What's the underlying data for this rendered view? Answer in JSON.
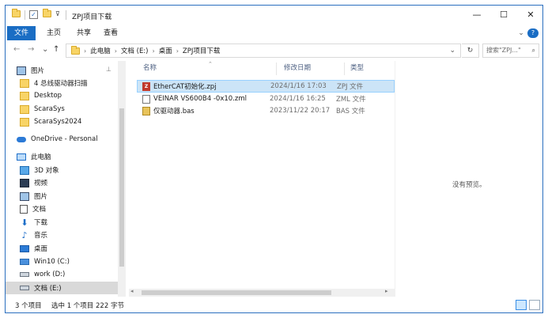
{
  "window": {
    "title": "ZPJ项目下载",
    "controls": {
      "minimize": "—",
      "maximize": "☐",
      "close": "✕"
    }
  },
  "ribbon": {
    "tabs": [
      "文件",
      "主页",
      "共享",
      "查看"
    ],
    "active_tab": 0,
    "help_glyph": "?"
  },
  "address": {
    "crumbs": [
      "此电脑",
      "文档 (E:)",
      "桌面",
      "ZPJ项目下载"
    ],
    "search_placeholder": "搜索\"ZPJ...\"",
    "nav": {
      "back": "←",
      "forward": "→",
      "recent": "⌄",
      "up": "↑"
    }
  },
  "nav_pane": {
    "items": [
      {
        "label": "图片",
        "icon": "picture-icon",
        "pinned": true
      },
      {
        "label": "4 总线驱动器扫描",
        "icon": "folder-icon"
      },
      {
        "label": "Desktop",
        "icon": "folder-icon"
      },
      {
        "label": "ScaraSys",
        "icon": "folder-icon"
      },
      {
        "label": "ScaraSys2024",
        "icon": "folder-icon"
      },
      {
        "label": "OneDrive - Personal",
        "icon": "onedrive-icon"
      },
      {
        "label": "此电脑",
        "icon": "this-pc-icon"
      },
      {
        "label": "3D 对象",
        "icon": "3d-objects-icon"
      },
      {
        "label": "视频",
        "icon": "video-icon"
      },
      {
        "label": "图片",
        "icon": "picture-icon"
      },
      {
        "label": "文档",
        "icon": "document-icon"
      },
      {
        "label": "下载",
        "icon": "download-icon"
      },
      {
        "label": "音乐",
        "icon": "music-icon"
      },
      {
        "label": "桌面",
        "icon": "desktop-icon"
      },
      {
        "label": "Win10 (C:)",
        "icon": "system-drive-icon"
      },
      {
        "label": "work (D:)",
        "icon": "drive-icon"
      },
      {
        "label": "文档 (E:)",
        "icon": "drive-icon",
        "selected": true
      }
    ]
  },
  "file_list": {
    "columns": [
      "名称",
      "修改日期",
      "类型"
    ],
    "rows": [
      {
        "name": "EtherCAT初始化.zpj",
        "date": "2024/1/16 17:03",
        "type": "ZPJ 文件",
        "icon": "zpj-file-icon",
        "selected": true
      },
      {
        "name": "VEINAR VS600B4 -0x10.zml",
        "date": "2024/1/16 16:25",
        "type": "ZML 文件",
        "icon": "zml-file-icon"
      },
      {
        "name": "仅驱动器.bas",
        "date": "2023/11/22 20:17",
        "type": "BAS 文件",
        "icon": "bas-file-icon"
      }
    ]
  },
  "preview": {
    "text": "没有预览。"
  },
  "status": {
    "item_count": "3 个项目",
    "selection": "选中 1 个项目  222 字节"
  }
}
